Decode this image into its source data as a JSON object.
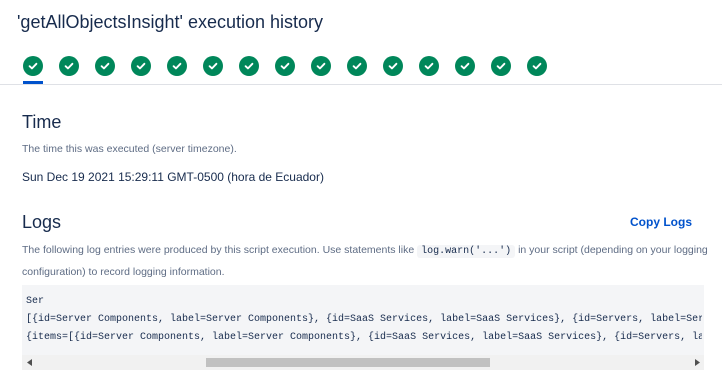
{
  "page": {
    "title": "'getAllObjectsInsight' execution history"
  },
  "runs": {
    "count": 15,
    "status": "success",
    "selected_index": 0,
    "icon": "check-icon",
    "color_success": "#00875a",
    "color_selected": "#0052cc"
  },
  "time_section": {
    "heading": "Time",
    "description": "The time this was executed (server timezone).",
    "value": "Sun Dec 19 2021 15:29:11 GMT-0500 (hora de Ecuador)"
  },
  "logs_section": {
    "heading": "Logs",
    "copy_label": "Copy Logs",
    "description_before": "The following log entries were produced by this script execution. Use statements like",
    "description_code": "log.warn('...')",
    "description_after": "in your script (depending on your logging configuration) to record logging information.",
    "lines": [
      "Ser",
      "[{id=Server Components, label=Server Components}, {id=SaaS Services, label=SaaS Services}, {id=Servers, label=Servers}]",
      "{items=[{id=Server Components, label=Server Components}, {id=SaaS Services, label=SaaS Services}, {id=Servers, label=Servers}]}"
    ],
    "scrollbar": {
      "left_icon": "triangle-left-icon",
      "right_icon": "triangle-right-icon"
    }
  }
}
